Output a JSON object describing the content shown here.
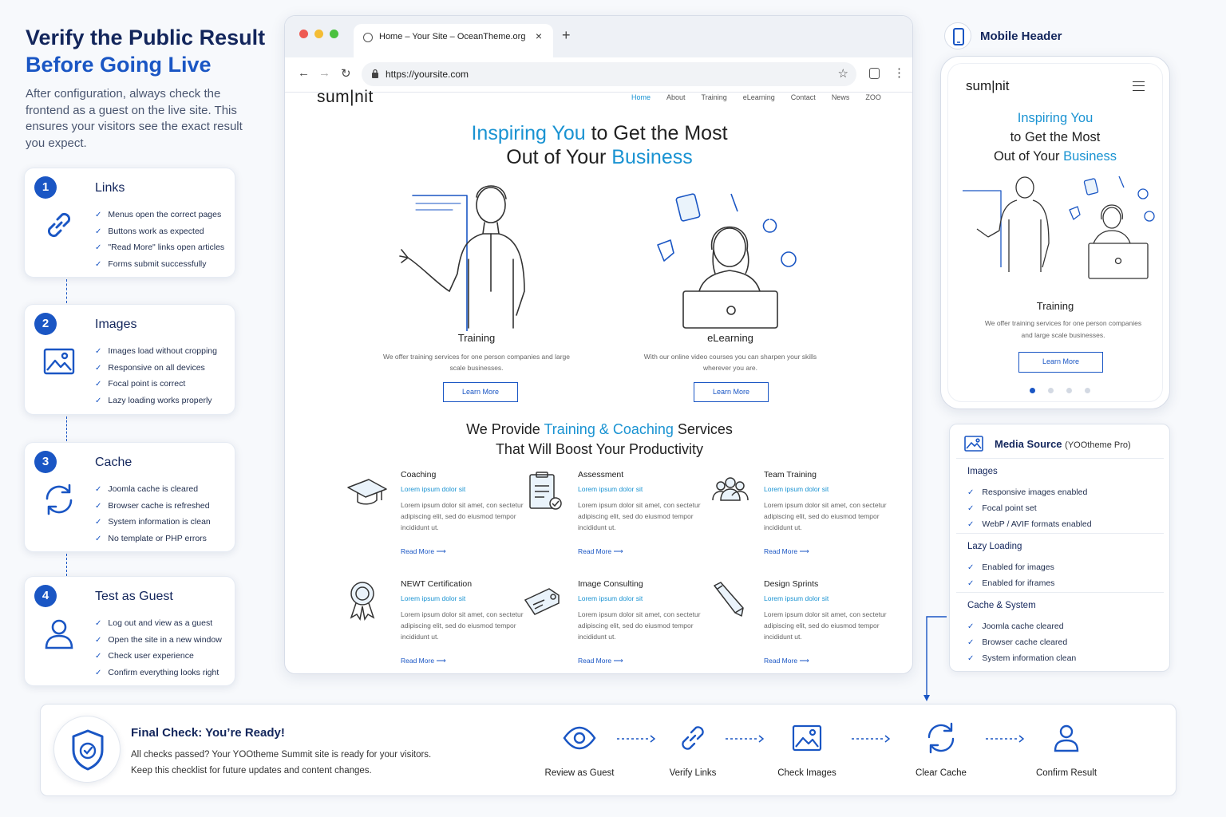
{
  "left_panel": {
    "title_line1": "Verify the Public Result",
    "title_line2": "Before Going Live",
    "intro": "After configuration, always check the frontend as a guest on the live site. This ensures your visitors see the exact result you expect.",
    "cards": [
      {
        "number": "1",
        "title": "Links",
        "icon": "link-icon",
        "checks": [
          "Menus open the correct pages",
          "Buttons work as expected",
          "\"Read More\" links open articles",
          "Forms submit successfully"
        ]
      },
      {
        "number": "2",
        "title": "Images",
        "icon": "image-icon",
        "checks": [
          "Images load without cropping",
          "Responsive on all devices",
          "Focal point is correct",
          "Lazy loading works properly"
        ]
      },
      {
        "number": "3",
        "title": "Cache",
        "icon": "refresh-icon",
        "checks": [
          "Joomla cache is cleared",
          "Browser cache is refreshed",
          "System information is clean",
          "No template or PHP errors"
        ]
      },
      {
        "number": "4",
        "title": "Test as Guest",
        "icon": "user-icon",
        "checks": [
          "Log out and view as a guest",
          "Open the site in a new window",
          "Check user experience",
          "Confirm everything looks right"
        ]
      }
    ]
  },
  "browser": {
    "tab_title": "Home – Your Site – OceanTheme.org",
    "url": "https://yoursite.com",
    "site": {
      "logo": "sum|nit",
      "nav": [
        "Home",
        "About",
        "Training",
        "eLearning",
        "Contact",
        "News",
        "ZOO"
      ],
      "hero_accent1": "Inspiring You",
      "hero_plain1": " to Get the Most",
      "hero_plain2": "Out of Your ",
      "hero_accent2": "Business",
      "features": [
        {
          "title": "Training",
          "desc": "We offer training services for one person companies and large scale businesses.",
          "button": "Learn More"
        },
        {
          "title": "eLearning",
          "desc": "With our online video courses you can sharpen your skills wherever you are.",
          "button": "Learn More"
        }
      ],
      "services_plain1": "We Provide ",
      "services_accent": "Training & Coaching",
      "services_plain2": " Services",
      "services_line2": "That Will Boost Your Productivity",
      "services": [
        {
          "title": "Coaching",
          "icon": "graduation-cap-icon",
          "subtitle": "Lorem ipsum dolor sit",
          "body": "Lorem ipsum dolor sit amet, con sectetur adipiscing elit, sed do eiusmod tempor incididunt ut.",
          "more": "Read More"
        },
        {
          "title": "Assessment",
          "icon": "clipboard-check-icon",
          "subtitle": "Lorem ipsum dolor sit",
          "body": "Lorem ipsum dolor sit amet, con sectetur adipiscing elit, sed do eiusmod tempor incididunt ut.",
          "more": "Read More"
        },
        {
          "title": "Team Training",
          "icon": "team-icon",
          "subtitle": "Lorem ipsum dolor sit",
          "body": "Lorem ipsum dolor sit amet, con sectetur adipiscing elit, sed do eiusmod tempor incididunt ut.",
          "more": "Read More"
        },
        {
          "title": "NEWT Certification",
          "icon": "award-ribbon-icon",
          "subtitle": "Lorem ipsum dolor sit",
          "body": "Lorem ipsum dolor sit amet, con sectetur adipiscing elit, sed do eiusmod tempor incididunt ut.",
          "more": "Read More"
        },
        {
          "title": "Image Consulting",
          "icon": "tag-icon",
          "subtitle": "Lorem ipsum dolor sit",
          "body": "Lorem ipsum dolor sit amet, con sectetur adipiscing elit, sed do eiusmod tempor incididunt ut.",
          "more": "Read More"
        },
        {
          "title": "Design Sprints",
          "icon": "pencil-icon",
          "subtitle": "Lorem ipsum dolor sit",
          "body": "Lorem ipsum dolor sit amet, con sectetur adipiscing elit, sed do eiusmod tempor incididunt ut.",
          "more": "Read More"
        }
      ]
    }
  },
  "mobile": {
    "label": "Mobile Header",
    "logo": "sum|nit",
    "hero_accent1": "Inspiring You",
    "hero_line2": "to Get the Most",
    "hero_plain3": "Out of Your ",
    "hero_accent2": "Business",
    "feature_title": "Training",
    "feature_desc": "We offer training services for one person companies and large scale businesses.",
    "button": "Learn More",
    "carousel_active": 1,
    "carousel_count": 4
  },
  "media_source": {
    "title": "Media Source",
    "subtitle": "(YOOtheme Pro)",
    "sections": [
      {
        "title": "Images",
        "items": [
          "Responsive images enabled",
          "Focal point set",
          "WebP / AVIF formats enabled"
        ]
      },
      {
        "title": "Lazy Loading",
        "items": [
          "Enabled for images",
          "Enabled for iframes"
        ]
      },
      {
        "title": "Cache & System",
        "items": [
          "Joomla cache cleared",
          "Browser cache cleared",
          "System information clean"
        ]
      }
    ]
  },
  "final": {
    "title": "Final Check: You’re Ready!",
    "line1": "All checks passed? Your YOOtheme Summit site is ready for your visitors.",
    "line2": "Keep this checklist for future updates and content changes.",
    "steps": [
      {
        "label": "Review as Guest",
        "icon": "eye-icon"
      },
      {
        "label": "Verify Links",
        "icon": "link-icon"
      },
      {
        "label": "Check Images",
        "icon": "image-icon"
      },
      {
        "label": "Clear Cache",
        "icon": "refresh-icon"
      },
      {
        "label": "Confirm Result",
        "icon": "user-icon"
      }
    ]
  },
  "colors": {
    "navy": "#13265c",
    "brand_blue": "#1a56c4",
    "site_accent": "#1a93d2"
  }
}
